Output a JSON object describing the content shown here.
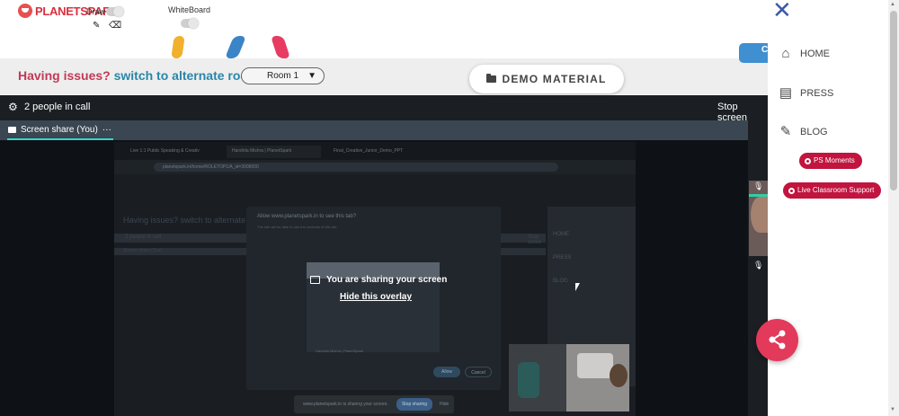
{
  "toolbar": {
    "logo_text": "PLANETSPARK",
    "draw_label": "Draw",
    "whiteboard_label": "WhiteBoard",
    "pencil_icon": "pencil-icon",
    "eraser_icon": "eraser-icon"
  },
  "issue_bar": {
    "prefix": "Having issues?",
    "link": "switch to alternate room",
    "room_selected": "Room 1"
  },
  "demo_material": {
    "label": "DEMO MATERIAL"
  },
  "call": {
    "people_count": "2 people in call",
    "stop_screen": "Stop screen",
    "tab_label": "Screen share (You)",
    "tab_more": "···"
  },
  "shared_screen": {
    "browser_tabs": [
      "Live 1:1 Public Speaking & Creativ",
      "Harshita Mishra | PlanetSpark",
      "Final_Creative_Junior_Demo_PPT"
    ],
    "address": "planetspark.in/home/ROLETOP1/A_id=3008000",
    "dialog_title": "Allow www.planetspark.in to see this tab?",
    "dialog_sub": "The site will be able to see the contents of this tab",
    "preview_footer": "Harshita Mishra | PlanetSpark",
    "allow_btn": "Allow",
    "cancel_btn": "Cancel",
    "dim_issue": "Having issues? switch to alternate roo",
    "dim_people": "2 people in call",
    "dim_tab": "Screen share (You)",
    "dim_stop": "Stop scree",
    "dim_side": [
      "HOME",
      "PRESS",
      "BLOG"
    ],
    "share_notice": "www.planetspark.in is sharing your screen.",
    "share_stop": "Stop sharing",
    "share_hide": "Hide"
  },
  "overlay": {
    "title": "You are sharing your screen",
    "hide_link": "Hide this overlay"
  },
  "sidebar": {
    "close": "✕",
    "items": [
      {
        "label": "HOME",
        "icon": "home-icon"
      },
      {
        "label": "PRESS",
        "icon": "newspaper-icon"
      },
      {
        "label": "BLOG",
        "icon": "pencil-icon"
      }
    ],
    "ps_moments": "PS Moments",
    "live_support": "Live Classroom Support",
    "chat_tab": "C"
  },
  "colors": {
    "brand_red": "#c1143e",
    "link_blue": "#2a86a8",
    "issue_red": "#c03a55",
    "fab": "#e3395b",
    "active_tab": "#39d4cc"
  }
}
